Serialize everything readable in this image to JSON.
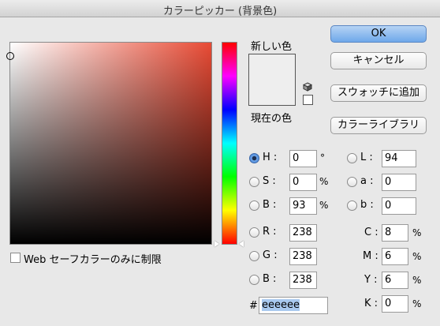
{
  "window": {
    "title": "カラーピッカー (背景色)"
  },
  "buttons": {
    "ok": "OK",
    "cancel": "キャンセル",
    "add_swatch": "スウォッチに追加",
    "library": "カラーライブラリ"
  },
  "swatch": {
    "new_label": "新しい色",
    "current_label": "現在の色",
    "color": "#eeeeee"
  },
  "web_safe": {
    "label": "Web セーフカラーのみに制限",
    "checked": false
  },
  "hsb": [
    {
      "label": "H :",
      "value": "0",
      "unit": "°",
      "selected": true
    },
    {
      "label": "S :",
      "value": "0",
      "unit": "%",
      "selected": false
    },
    {
      "label": "B :",
      "value": "93",
      "unit": "%",
      "selected": false
    }
  ],
  "rgb": [
    {
      "label": "R :",
      "value": "238"
    },
    {
      "label": "G :",
      "value": "238"
    },
    {
      "label": "B :",
      "value": "238"
    }
  ],
  "lab": [
    {
      "label": "L :",
      "value": "94"
    },
    {
      "label": "a :",
      "value": "0"
    },
    {
      "label": "b :",
      "value": "0"
    }
  ],
  "cmyk": [
    {
      "label": "C :",
      "value": "8",
      "unit": "%"
    },
    {
      "label": "M :",
      "value": "6",
      "unit": "%"
    },
    {
      "label": "Y :",
      "value": "6",
      "unit": "%"
    },
    {
      "label": "K :",
      "value": "0",
      "unit": "%"
    }
  ],
  "hex": {
    "label": "#",
    "value": "eeeeee"
  }
}
